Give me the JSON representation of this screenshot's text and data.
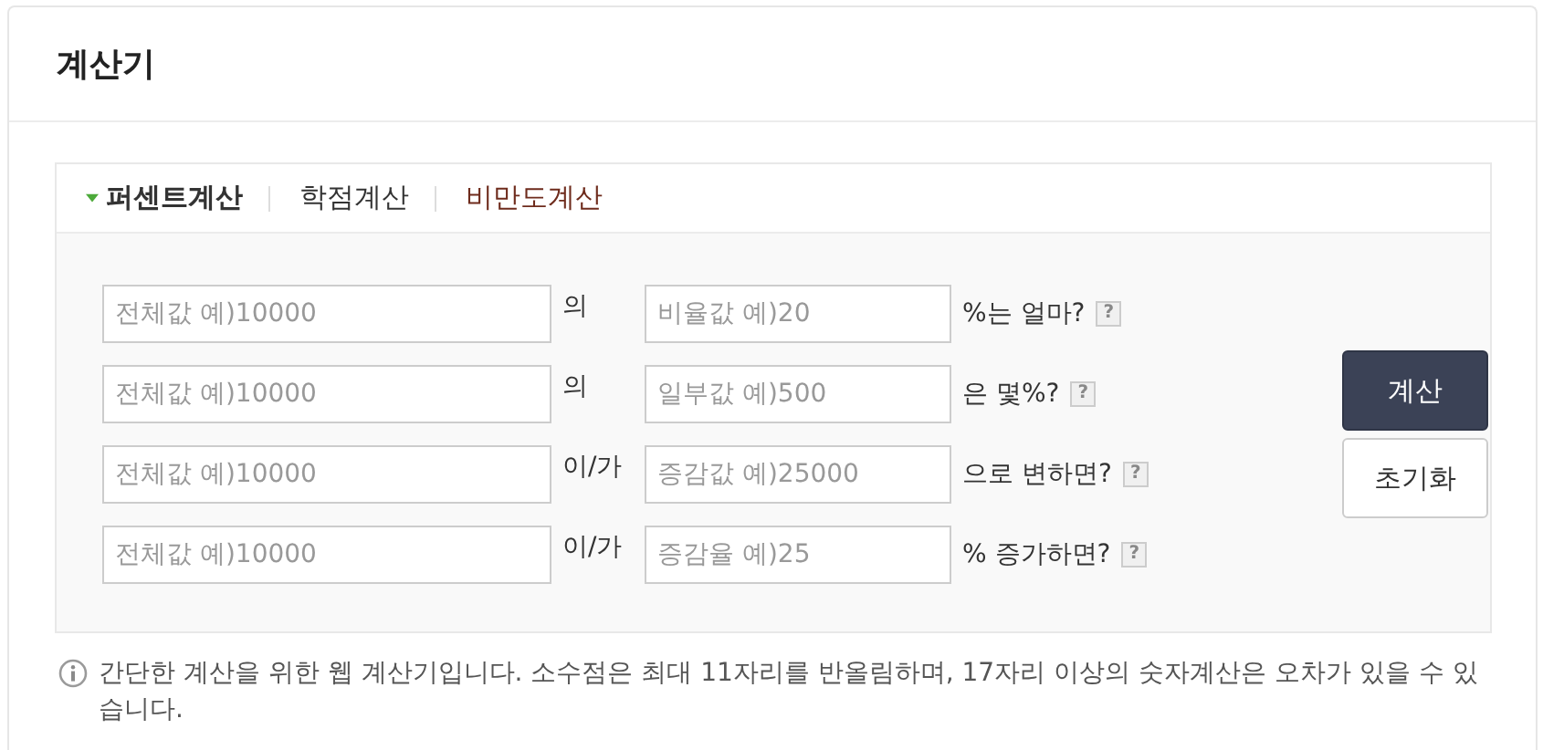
{
  "title": "계산기",
  "tabs": [
    {
      "label": "퍼센트계산",
      "selected": true,
      "color": "#333333"
    },
    {
      "label": "학점계산",
      "selected": false,
      "color": "#333333"
    },
    {
      "label": "비만도계산",
      "selected": false,
      "color": "#6e2b1c"
    }
  ],
  "rows": [
    {
      "first_placeholder": "전체값 예)10000",
      "connector": "의",
      "second_placeholder": "비율값 예)20",
      "suffix": "%는 얼마?",
      "help": "?"
    },
    {
      "first_placeholder": "전체값 예)10000",
      "connector": "의",
      "second_placeholder": "일부값 예)500",
      "suffix": "은 몇%?",
      "help": "?"
    },
    {
      "first_placeholder": "전체값 예)10000",
      "connector": "이/가",
      "second_placeholder": "증감값 예)25000",
      "suffix": "으로 변하면?",
      "help": "?"
    },
    {
      "first_placeholder": "전체값 예)10000",
      "connector": "이/가",
      "second_placeholder": "증감율 예)25",
      "suffix": "% 증가하면?",
      "help": "?"
    }
  ],
  "buttons": [
    {
      "label": "계산",
      "kind": "primary"
    },
    {
      "label": "초기화",
      "kind": "secondary"
    }
  ],
  "note": "간단한 계산을 위한 웹 계산기입니다. 소수점은 최대 11자리를 반올림하며, 17자리 이상의 숫자계산은 오차가 있을 수 있습니다."
}
